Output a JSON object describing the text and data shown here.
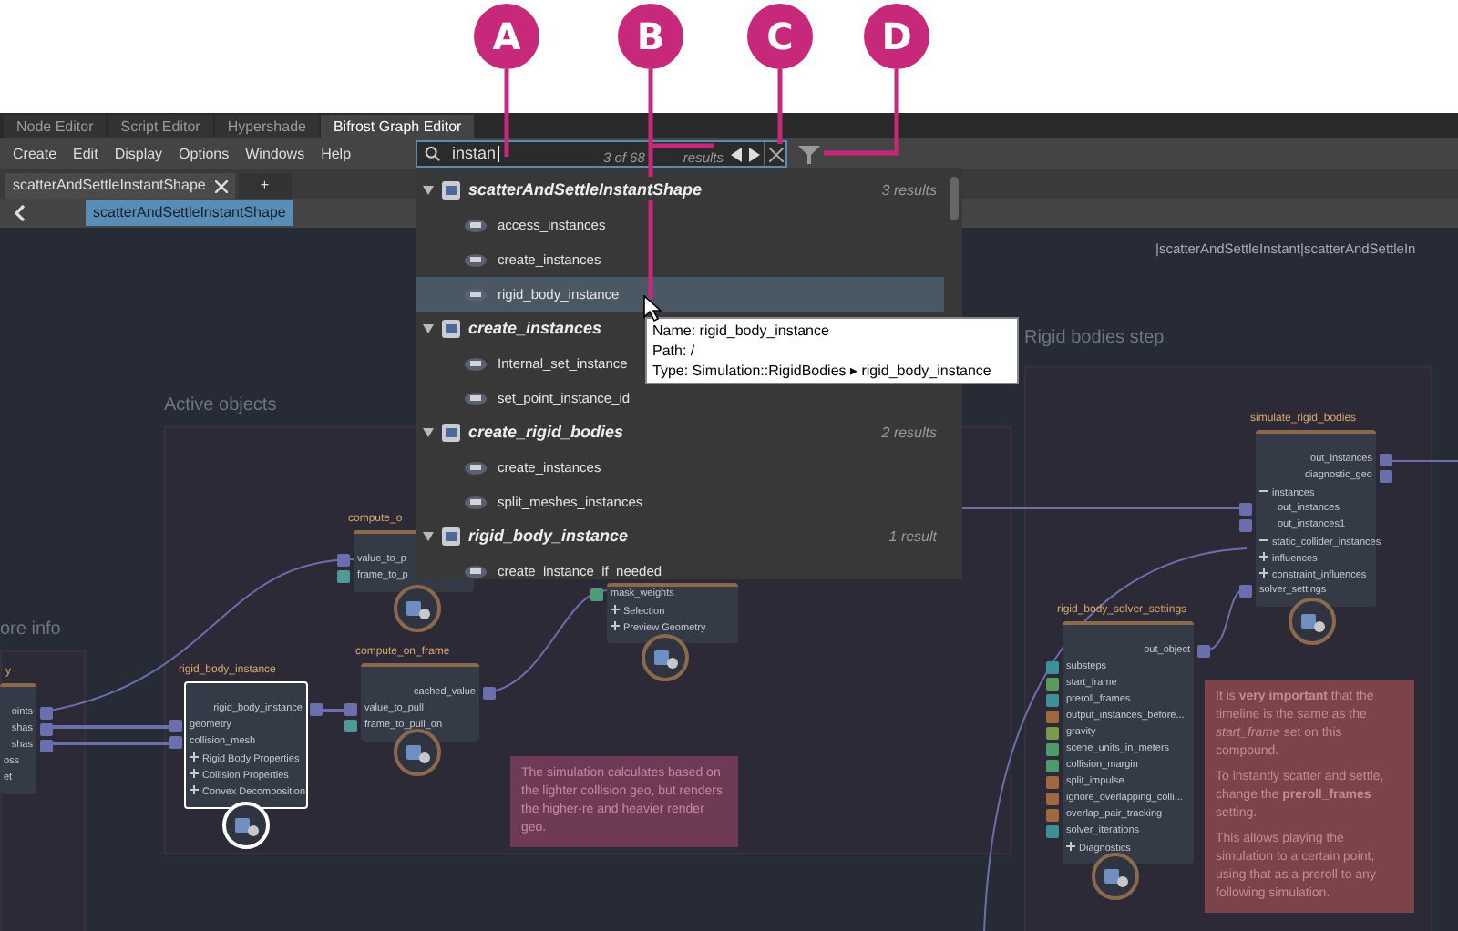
{
  "callouts": [
    "A",
    "B",
    "C",
    "D"
  ],
  "editor_tabs": [
    {
      "label": "Node Editor",
      "selected": false
    },
    {
      "label": "Script Editor",
      "selected": false
    },
    {
      "label": "Hypershade",
      "selected": false
    },
    {
      "label": "Bifrost Graph Editor",
      "selected": true
    }
  ],
  "menu": [
    "Create",
    "Edit",
    "Display",
    "Options",
    "Windows",
    "Help"
  ],
  "search": {
    "value": "instan",
    "result_count": "3 of 68",
    "result_suffix": "results"
  },
  "document_tabs": [
    {
      "label": "scatterAndSettleInstantShape",
      "selected": true
    },
    {
      "label": "+",
      "selected": false
    }
  ],
  "breadcrumb": [
    {
      "label": "scatterAndSettleInstantShape",
      "selected": true
    }
  ],
  "path": "|scatterAndSettleInstant|scatterAndSettleIn",
  "search_results": [
    {
      "title": "scatterAndSettleInstantShape",
      "count": "3 results",
      "expanded": true,
      "children": [
        {
          "label": "access_instances",
          "selected": false
        },
        {
          "label": "create_instances",
          "selected": false
        },
        {
          "label": "rigid_body_instance",
          "selected": true
        }
      ]
    },
    {
      "title": "create_instances",
      "expanded": true,
      "children": [
        {
          "label": "Internal_set_instance",
          "selected": false
        },
        {
          "label": "set_point_instance_id",
          "selected": false
        }
      ]
    },
    {
      "title": "create_rigid_bodies",
      "count": "2 results",
      "expanded": true,
      "children": [
        {
          "label": "create_instances",
          "selected": false
        },
        {
          "label": "split_meshes_instances",
          "selected": false
        }
      ]
    },
    {
      "title": "rigid_body_instance",
      "count": "1 result",
      "expanded": true,
      "children": [
        {
          "label": "create_instance_if_needed",
          "selected": false
        }
      ]
    }
  ],
  "tooltip": [
    "Name: rigid_body_instance",
    "Path: /",
    "Type: Simulation::RigidBodies ▸ rigid_body_instance"
  ],
  "groups": [
    {
      "title": "Active objects"
    },
    {
      "title": "ore info"
    },
    {
      "title": "Rigid bodies step"
    }
  ],
  "nodes": [
    {
      "title": "y",
      "selected": false,
      "ports": [
        {
          "kind": "output",
          "label": "oints",
          "color": "#6b6fae"
        },
        {
          "kind": "output",
          "label": "shas",
          "color": "#6b6fae"
        },
        {
          "kind": "output",
          "label": "shas",
          "color": "#6b6fae"
        },
        {
          "kind": "text",
          "label": "oss"
        },
        {
          "kind": "text",
          "label": "et"
        }
      ]
    },
    {
      "title": "compute_o",
      "selected": false,
      "ports": [
        {
          "kind": "input",
          "label": "value_to_p",
          "color": "#6b6fae"
        },
        {
          "kind": "input",
          "label": "frame_to_p",
          "color": "#4f9a97"
        }
      ]
    },
    {
      "selected": false,
      "ports": [
        {
          "kind": "input",
          "label": "mask_weights",
          "color": "#4f9a7a"
        },
        {
          "kind": "section",
          "label": "Selection",
          "expanded": false
        },
        {
          "kind": "section",
          "label": "Preview Geometry",
          "expanded": false
        }
      ]
    },
    {
      "title": "compute_on_frame",
      "selected": false,
      "ports": [
        {
          "kind": "output",
          "label": "cached_value",
          "color": "#6b6fae"
        },
        {
          "kind": "input",
          "label": "value_to_pull",
          "color": "#6b6fae"
        },
        {
          "kind": "input",
          "label": "frame_to_pull_on",
          "color": "#4f9a97"
        }
      ]
    },
    {
      "title": "rigid_body_instance",
      "selected": true,
      "ports": [
        {
          "kind": "output",
          "label": "rigid_body_instance",
          "color": "#6b6fae"
        },
        {
          "kind": "input",
          "label": "geometry",
          "color": "#6b6fae"
        },
        {
          "kind": "input",
          "label": "collision_mesh",
          "color": "#6b6fae"
        },
        {
          "kind": "section",
          "label": "Rigid Body Properties",
          "expanded": false
        },
        {
          "kind": "section",
          "label": "Collision Properties",
          "expanded": false
        },
        {
          "kind": "section",
          "label": "Convex Decomposition",
          "expanded": false
        }
      ]
    },
    {
      "title": "simulate_rigid_bodies",
      "selected": false,
      "ports": [
        {
          "kind": "output",
          "label": "out_instances",
          "color": "#6b6fae"
        },
        {
          "kind": "output",
          "label": "diagnostic_geo",
          "color": "#6b6fae"
        },
        {
          "kind": "section",
          "label": "instances",
          "expanded": true,
          "children": [
            {
              "kind": "input",
              "label": "out_instances",
              "color": "#6b6fae"
            },
            {
              "kind": "input",
              "label": "out_instances1",
              "color": "#6b6fae"
            }
          ]
        },
        {
          "kind": "section",
          "label": "static_collider_instances",
          "expanded": true
        },
        {
          "kind": "section",
          "label": "influences",
          "expanded": false
        },
        {
          "kind": "section",
          "label": "constraint_influences",
          "expanded": false
        },
        {
          "kind": "input",
          "label": "solver_settings",
          "color": "#6b6fae"
        }
      ]
    },
    {
      "title": "rigid_body_solver_settings",
      "selected": false,
      "ports": [
        {
          "kind": "output",
          "label": "out_object",
          "color": "#6b6fae"
        },
        {
          "kind": "input",
          "label": "substeps",
          "color": "#3f8f96"
        },
        {
          "kind": "input",
          "label": "start_frame",
          "color": "#5a9a5a"
        },
        {
          "kind": "input",
          "label": "preroll_frames",
          "color": "#3f8f96"
        },
        {
          "kind": "input",
          "label": "output_instances_before...",
          "color": "#a0683f"
        },
        {
          "kind": "input",
          "label": "gravity",
          "color": "#7a9a4a"
        },
        {
          "kind": "input",
          "label": "scene_units_in_meters",
          "color": "#4f9a6a"
        },
        {
          "kind": "input",
          "label": "collision_margin",
          "color": "#4f9a6a"
        },
        {
          "kind": "input",
          "label": "split_impulse",
          "color": "#a0683f"
        },
        {
          "kind": "input",
          "label": "ignore_overlapping_colli...",
          "color": "#a0683f"
        },
        {
          "kind": "input",
          "label": "overlap_pair_tracking",
          "color": "#a0683f"
        },
        {
          "kind": "input",
          "label": "solver_iterations",
          "color": "#3f8f96"
        },
        {
          "kind": "section",
          "label": "Diagnostics",
          "expanded": false
        }
      ]
    }
  ],
  "notes": [
    {
      "color": "#6e3a55",
      "paragraphs": [
        "The simulation calculates based on the lighter collision geo, but renders the higher-re and heavier render geo."
      ]
    },
    {
      "color": "#7a4448",
      "paragraphs": [
        "It is **very important** that the timeline is the same as the *start_frame* set on this compound.",
        "To instantly scatter and settle, change the **preroll_frames** setting.",
        "This allows playing the simulation to a certain point, using that as a preroll to any following simulation."
      ]
    }
  ]
}
